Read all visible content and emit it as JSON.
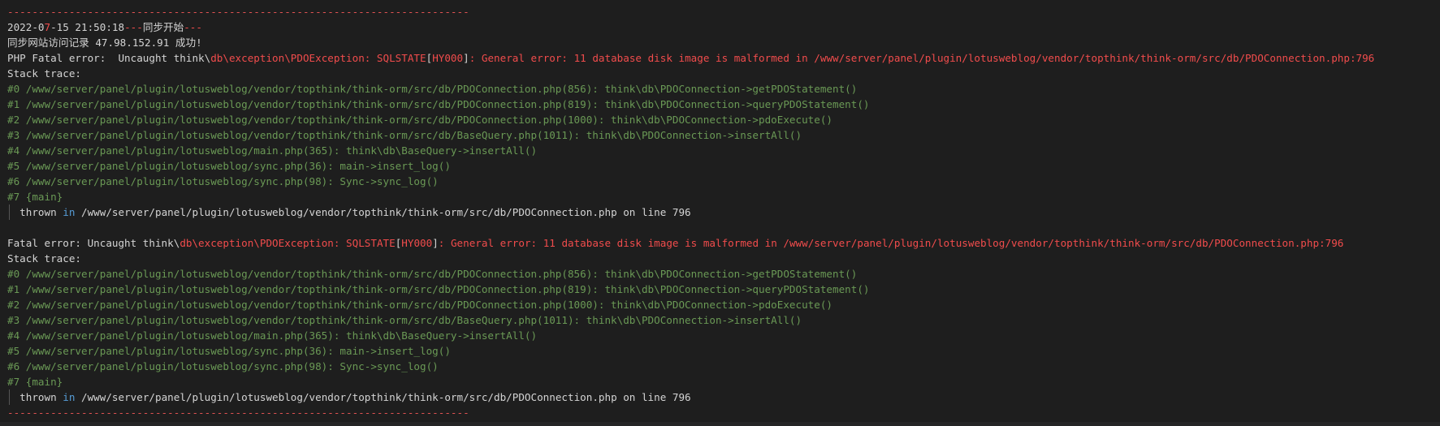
{
  "colors": {
    "background": "#1e1e1e",
    "error_red": "#f14c4c",
    "trace_green": "#6a9955",
    "text": "#d4d4d4",
    "keyword_blue": "#569cd6"
  },
  "separator": "---------------------------------------------------------------------------",
  "header": {
    "date_pre": "2022-0",
    "date_red": "7",
    "date_post": "-15 21:50:18",
    "dash1": "---",
    "sync_start": "同步开始",
    "dash2": "---"
  },
  "sync_line": "同步网站访问记录 47.98.152.91 成功!",
  "errors": [
    {
      "prefix": "PHP Fatal error:  Uncaught think\\",
      "ns": "db\\exception\\PDOException: SQLSTATE",
      "br_open": "[",
      "code": "HY000",
      "br_close": "]",
      "msg": ": General error: 11 database disk image is malformed in /www/server/panel/plugin/lotusweblog/vendor/topthink/think-orm/src/db/PDOConnection.php:796",
      "stack_label": "Stack trace:",
      "trace": [
        "#0 /www/server/panel/plugin/lotusweblog/vendor/topthink/think-orm/src/db/PDOConnection.php(856): think\\db\\PDOConnection->getPDOStatement()",
        "#1 /www/server/panel/plugin/lotusweblog/vendor/topthink/think-orm/src/db/PDOConnection.php(819): think\\db\\PDOConnection->queryPDOStatement()",
        "#2 /www/server/panel/plugin/lotusweblog/vendor/topthink/think-orm/src/db/PDOConnection.php(1000): think\\db\\PDOConnection->pdoExecute()",
        "#3 /www/server/panel/plugin/lotusweblog/vendor/topthink/think-orm/src/db/BaseQuery.php(1011): think\\db\\PDOConnection->insertAll()",
        "#4 /www/server/panel/plugin/lotusweblog/main.php(365): think\\db\\BaseQuery->insertAll()",
        "#5 /www/server/panel/plugin/lotusweblog/sync.php(36): main->insert_log()",
        "#6 /www/server/panel/plugin/lotusweblog/sync.php(98): Sync->sync_log()",
        "#7 {main}"
      ],
      "thrown_pre": "  thrown ",
      "thrown_in": "in",
      "thrown_post": " /www/server/panel/plugin/lotusweblog/vendor/topthink/think-orm/src/db/PDOConnection.php on line 796"
    },
    {
      "prefix": "Fatal error: Uncaught think\\",
      "ns": "db\\exception\\PDOException: SQLSTATE",
      "br_open": "[",
      "code": "HY000",
      "br_close": "]",
      "msg": ": General error: 11 database disk image is malformed in /www/server/panel/plugin/lotusweblog/vendor/topthink/think-orm/src/db/PDOConnection.php:796",
      "stack_label": "Stack trace:",
      "trace": [
        "#0 /www/server/panel/plugin/lotusweblog/vendor/topthink/think-orm/src/db/PDOConnection.php(856): think\\db\\PDOConnection->getPDOStatement()",
        "#1 /www/server/panel/plugin/lotusweblog/vendor/topthink/think-orm/src/db/PDOConnection.php(819): think\\db\\PDOConnection->queryPDOStatement()",
        "#2 /www/server/panel/plugin/lotusweblog/vendor/topthink/think-orm/src/db/PDOConnection.php(1000): think\\db\\PDOConnection->pdoExecute()",
        "#3 /www/server/panel/plugin/lotusweblog/vendor/topthink/think-orm/src/db/BaseQuery.php(1011): think\\db\\PDOConnection->insertAll()",
        "#4 /www/server/panel/plugin/lotusweblog/main.php(365): think\\db\\BaseQuery->insertAll()",
        "#5 /www/server/panel/plugin/lotusweblog/sync.php(36): main->insert_log()",
        "#6 /www/server/panel/plugin/lotusweblog/sync.php(98): Sync->sync_log()",
        "#7 {main}"
      ],
      "thrown_pre": "  thrown ",
      "thrown_in": "in",
      "thrown_post": " /www/server/panel/plugin/lotusweblog/vendor/topthink/think-orm/src/db/PDOConnection.php on line 796"
    }
  ]
}
